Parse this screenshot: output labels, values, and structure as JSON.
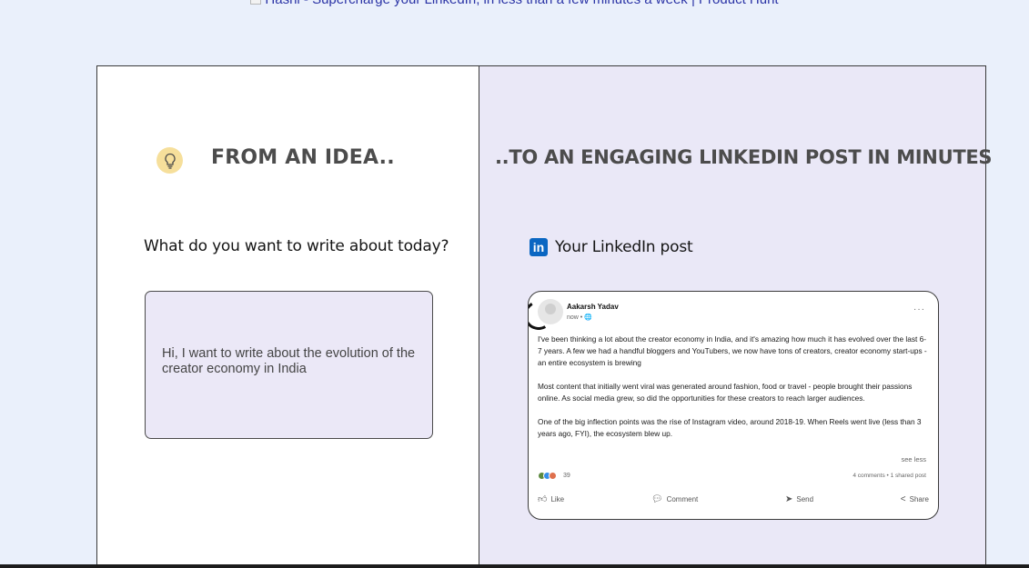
{
  "banner": {
    "alt_text": "Hashi - Supercharge your LinkedIn, in less than a few minutes a week | Product Hunt"
  },
  "left": {
    "title": "FROM AN IDEA..",
    "icon": "lightbulb-icon",
    "prompt_label": "What do you want to write about today?",
    "input_value": "Hi, I want to write about the evolution of the creator economy in India"
  },
  "right": {
    "title": "..TO AN ENGAGING LINKEDIN POST IN MINUTES",
    "linkedin_label": "Your LinkedIn post",
    "linkedin_logo_text": "in",
    "post": {
      "author": "Aakarsh Yadav",
      "time": "now • 🌐",
      "more": "···",
      "paragraphs": [
        "I've been thinking a lot about the creator economy in India, and it's amazing how much it has evolved over the last 6-7 years. A few we had a handful bloggers and YouTubers, we now have tons of creators, creator economy start-ups - an entire ecosystem is brewing",
        "Most content that initially went viral was generated around fashion, food or travel - people brought their passions online. As social media grew, so did the opportunities for these creators to reach larger audiences.",
        "One of the big inflection points was the rise of Instagram video, around 2018-19. When Reels went live (less than 3 years ago, FYI), the ecosystem blew up."
      ],
      "see_less": "see less",
      "reaction_count": "39",
      "stats": "4 comments • 1 shared post",
      "actions": {
        "like": "Like",
        "comment": "Comment",
        "send": "Send",
        "share": "Share"
      }
    }
  },
  "colors": {
    "accent_bulb": "#f6df9b",
    "linkedin_blue": "#0a66c2",
    "right_panel_bg": "#eae8f7"
  }
}
